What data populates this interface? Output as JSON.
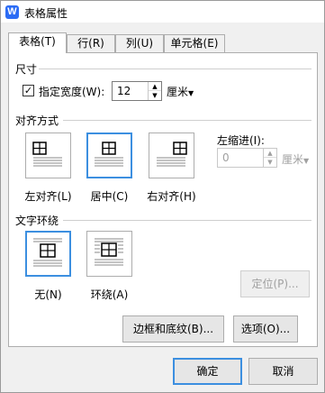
{
  "window": {
    "title": "表格属性",
    "app_icon_letter": "W"
  },
  "tabs": [
    "表格(T)",
    "行(R)",
    "列(U)",
    "单元格(E)"
  ],
  "size": {
    "group_label": "尺寸",
    "checkbox_label": "指定宽度(W):",
    "checked": true,
    "width_value": "12",
    "unit": "厘米"
  },
  "alignment": {
    "group_label": "对齐方式",
    "options": [
      {
        "label": "左对齐(L)",
        "selected": false
      },
      {
        "label": "居中(C)",
        "selected": true
      },
      {
        "label": "右对齐(H)",
        "selected": false
      }
    ],
    "indent_label": "左缩进(I):",
    "indent_value": "0",
    "indent_unit": "厘米"
  },
  "wrapping": {
    "group_label": "文字环绕",
    "options": [
      {
        "label": "无(N)",
        "selected": true
      },
      {
        "label": "环绕(A)",
        "selected": false
      }
    ],
    "position_button": "定位(P)..."
  },
  "buttons": {
    "borders_shading": "边框和底纹(B)...",
    "options": "选项(O)...",
    "ok": "确定",
    "cancel": "取消"
  },
  "colors": {
    "accent": "#3c8fe0",
    "app_icon": "#2c6cf5"
  }
}
